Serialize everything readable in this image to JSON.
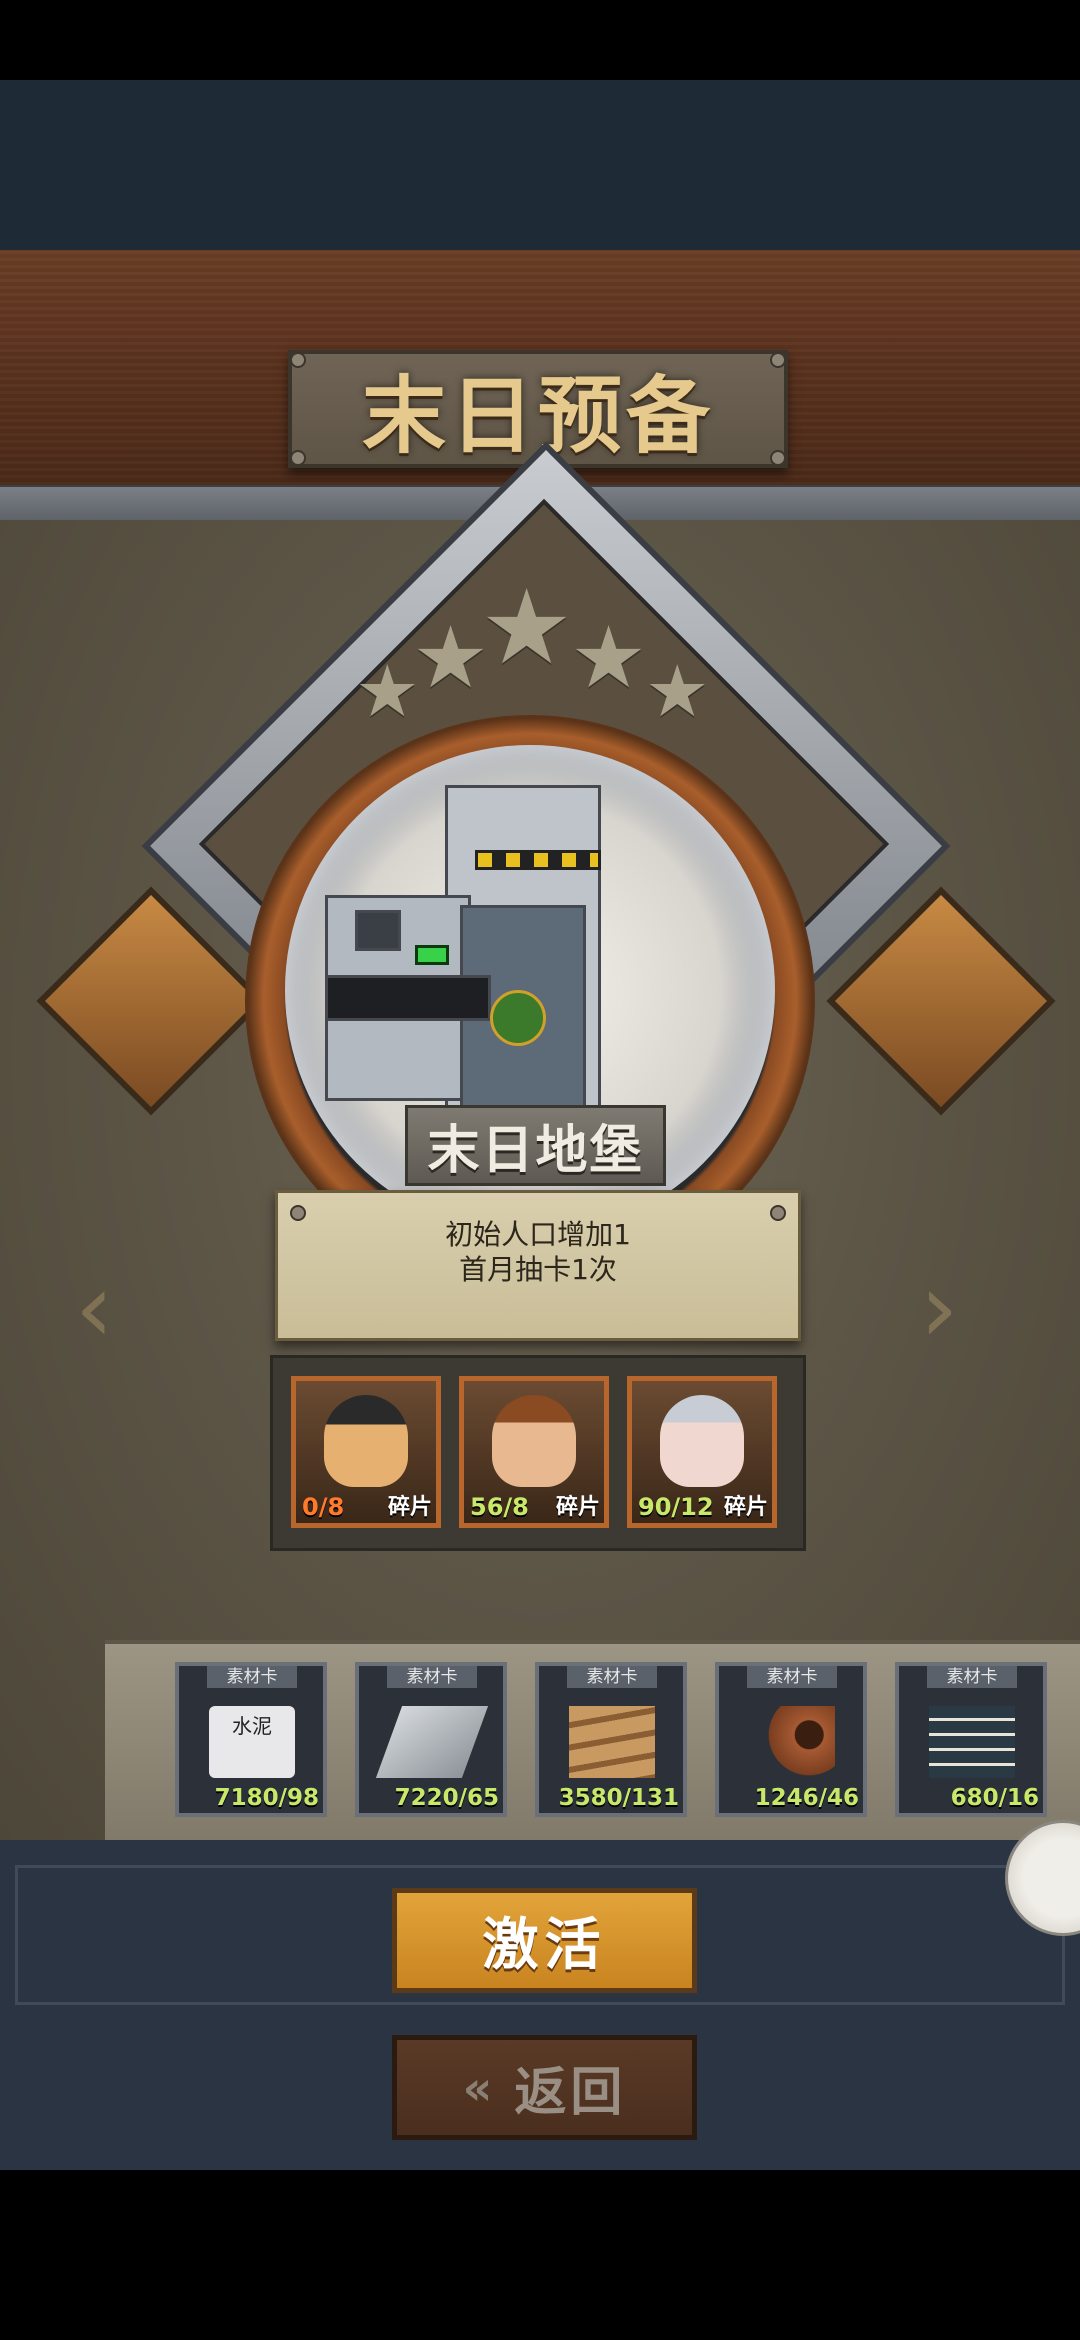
{
  "title": "末日预备",
  "building": {
    "name": "末日地堡",
    "stars": 5,
    "description_lines": [
      "初始人口增加1",
      "首月抽卡1次"
    ]
  },
  "heroes": [
    {
      "count": "0/8",
      "count_color": "#ff7a2a",
      "tag": "碎片"
    },
    {
      "count": "56/8",
      "count_color": "#c8e86a",
      "tag": "碎片"
    },
    {
      "count": "90/12",
      "count_color": "#c8e86a",
      "tag": "碎片"
    }
  ],
  "materials": [
    {
      "header": "素材卡",
      "count": "7180/98",
      "icon": "cement-bag-icon",
      "icon_label": "水泥"
    },
    {
      "header": "素材卡",
      "count": "7220/65",
      "icon": "steel-plate-icon"
    },
    {
      "header": "素材卡",
      "count": "3580/131",
      "icon": "wood-plank-icon"
    },
    {
      "header": "素材卡",
      "count": "1246/46",
      "icon": "pipe-icon"
    },
    {
      "header": "素材卡",
      "count": "680/16",
      "icon": "book-stack-icon"
    }
  ],
  "buttons": {
    "activate": "激活",
    "return": "返回"
  },
  "colors": {
    "accent": "#e2a43a",
    "count_ok": "#c8e86a",
    "count_short": "#ff7a2a"
  }
}
